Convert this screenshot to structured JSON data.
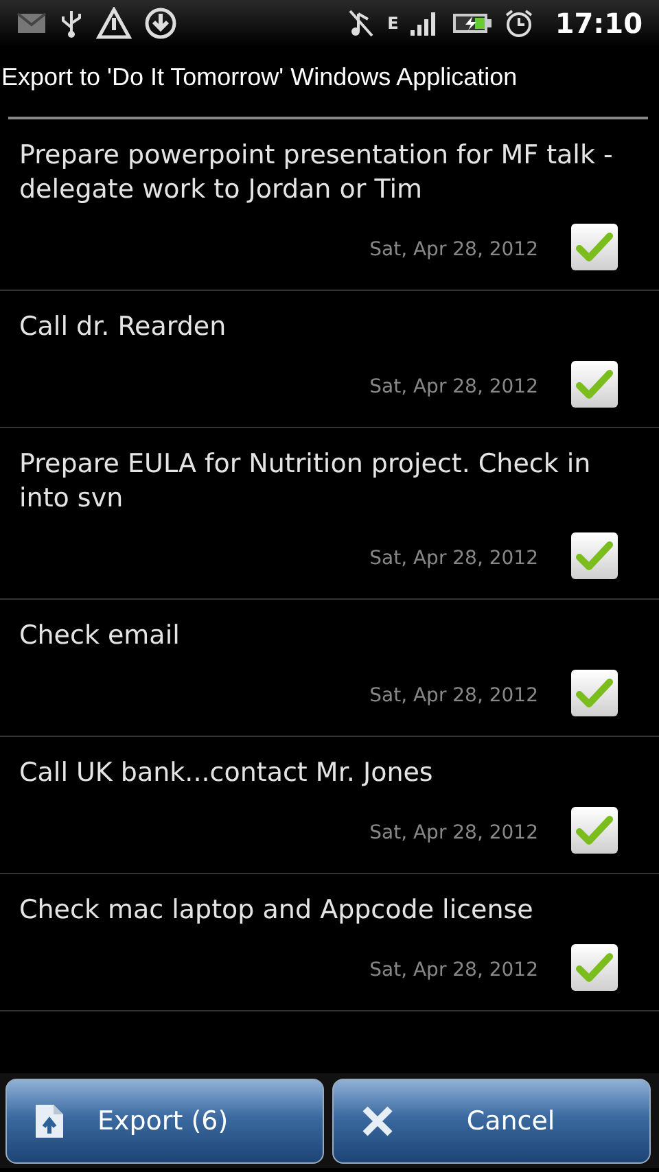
{
  "status_bar": {
    "network_type": "E",
    "time": "17:10"
  },
  "title": "Export to 'Do It Tomorrow' Windows Application",
  "items": [
    {
      "text": "Prepare powerpoint presentation for MF talk - delegate work to Jordan or Tim",
      "date": "Sat, Apr 28, 2012",
      "checked": true
    },
    {
      "text": "Call dr. Rearden",
      "date": "Sat, Apr 28, 2012",
      "checked": true
    },
    {
      "text": "Prepare EULA for Nutrition project. Check in into svn",
      "date": "Sat, Apr 28, 2012",
      "checked": true
    },
    {
      "text": "Check email",
      "date": "Sat, Apr 28, 2012",
      "checked": true
    },
    {
      "text": "Call UK bank...contact Mr. Jones",
      "date": "Sat, Apr 28, 2012",
      "checked": true
    },
    {
      "text": "Check mac laptop and Appcode license",
      "date": "Sat, Apr 28, 2012",
      "checked": true
    }
  ],
  "buttons": [
    {
      "kind": "export",
      "label": "Export (6)"
    },
    {
      "kind": "cancel",
      "label": "Cancel"
    }
  ]
}
